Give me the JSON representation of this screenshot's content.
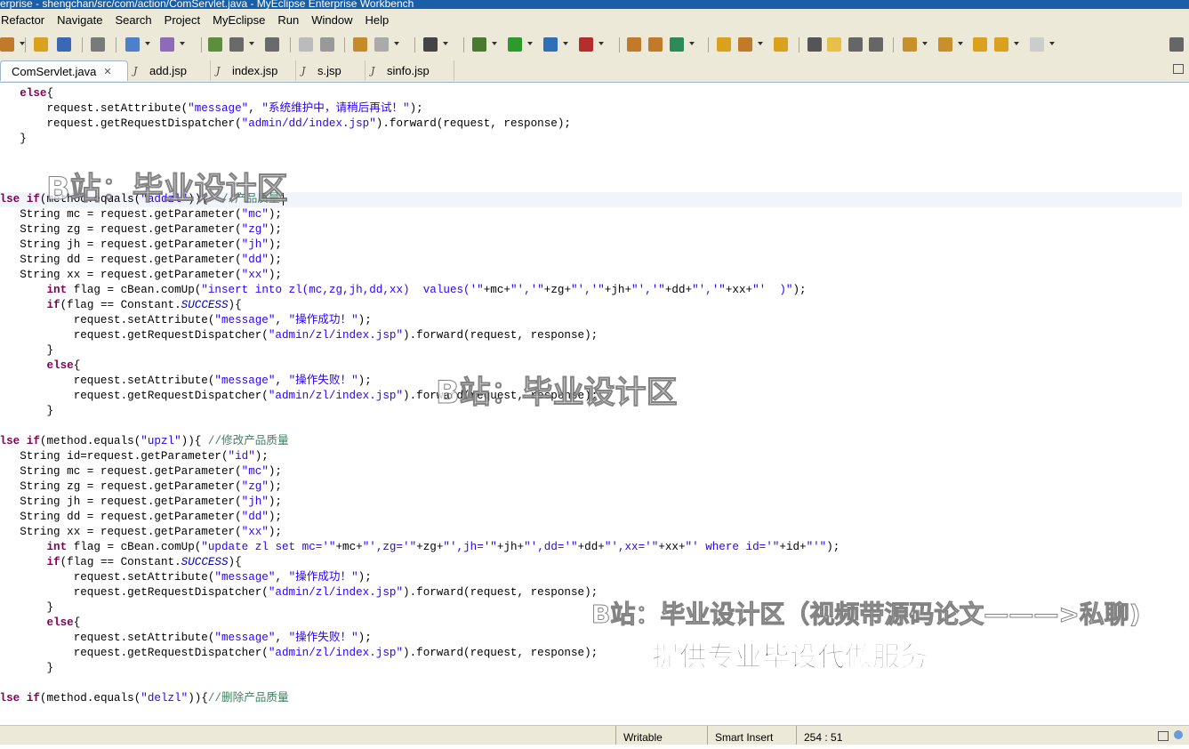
{
  "window": {
    "title": "erprise - shengchan/src/com/action/ComServlet.java - MyEclipse Enterprise Workbench"
  },
  "menu": [
    "Refactor",
    "Navigate",
    "Search",
    "Project",
    "MyEclipse",
    "Run",
    "Window",
    "Help"
  ],
  "tabs": [
    {
      "label": "ComServlet.java",
      "active": true,
      "close": "✕"
    },
    {
      "label": "add.jsp"
    },
    {
      "label": "index.jsp"
    },
    {
      "label": "s.jsp"
    },
    {
      "label": "sinfo.jsp"
    }
  ],
  "code": [
    "    else{",
    "        request.setAttribute(\"message\", \"系统维护中，请稍后再试！\");",
    "        request.getRequestDispatcher(\"admin/dd/index.jsp\").forward(request, response);",
    "    }",
    "}",
    "",
    "",
    "else if(method.equals(\"addzl\")){  //产品质量",
    "    String mc = request.getParameter(\"mc\");",
    "    String zg = request.getParameter(\"zg\");",
    "    String jh = request.getParameter(\"jh\");",
    "    String dd = request.getParameter(\"dd\");",
    "    String xx = request.getParameter(\"xx\");",
    "        int flag = cBean.comUp(\"insert into zl(mc,zg,jh,dd,xx)  values('\"+mc+\"','\"+zg+\"','\"+jh+\"','\"+dd+\"','\"+xx+\"'  )\");",
    "        if(flag == Constant.SUCCESS){",
    "            request.setAttribute(\"message\", \"操作成功！\");",
    "            request.getRequestDispatcher(\"admin/zl/index.jsp\").forward(request, response);",
    "        }",
    "        else{",
    "            request.setAttribute(\"message\", \"操作失败！\");",
    "            request.getRequestDispatcher(\"admin/zl/index.jsp\").forward(request, response);",
    "        }",
    "}",
    "else if(method.equals(\"upzl\")){ //修改产品质量",
    "    String id=request.getParameter(\"id\");",
    "    String mc = request.getParameter(\"mc\");",
    "    String zg = request.getParameter(\"zg\");",
    "    String jh = request.getParameter(\"jh\");",
    "    String dd = request.getParameter(\"dd\");",
    "    String xx = request.getParameter(\"xx\");",
    "        int flag = cBean.comUp(\"update zl set mc='\"+mc+\"',zg='\"+zg+\"',jh='\"+jh+\"',dd='\"+dd+\"',xx='\"+xx+\"' where id='\"+id+\"'\");",
    "        if(flag == Constant.SUCCESS){",
    "            request.setAttribute(\"message\", \"操作成功！\");",
    "            request.getRequestDispatcher(\"admin/zl/index.jsp\").forward(request, response);",
    "        }",
    "        else{",
    "            request.setAttribute(\"message\", \"操作失败！\");",
    "            request.getRequestDispatcher(\"admin/zl/index.jsp\").forward(request, response);",
    "        }",
    "}",
    "else if(method.equals(\"delzl\")){//删除产品质量"
  ],
  "current_line_index": 7,
  "watermarks": {
    "top": "B站：毕业设计区",
    "middle": "B站：毕业设计区",
    "bottom": "B站：毕业设计区（视频带源码论文———>私聊)",
    "subtitle": "提供专业毕设代做服务"
  },
  "status": {
    "mode": "Writable",
    "insert": "Smart Insert",
    "position": "254 : 51"
  },
  "colors": {
    "keyword": "#7f0055",
    "string": "#2a00ff",
    "comment": "#3f7f5f",
    "constant": "#0000c0",
    "chrome": "#ece9d8"
  }
}
